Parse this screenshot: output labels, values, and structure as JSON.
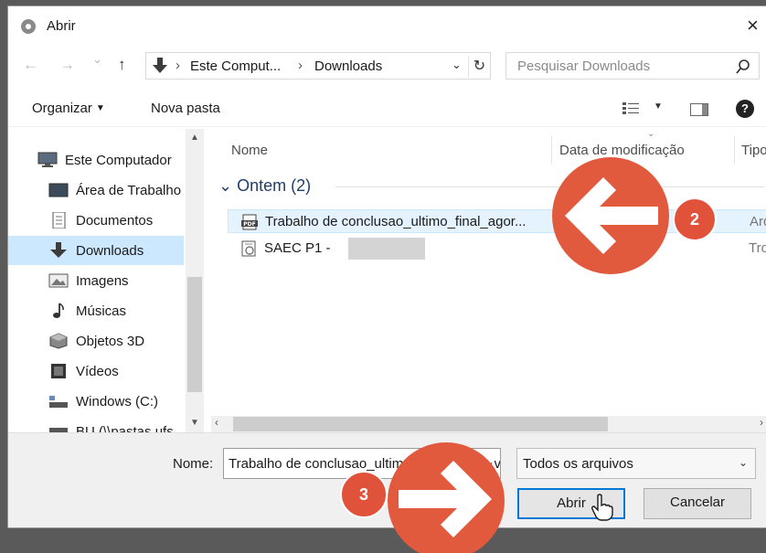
{
  "dialog": {
    "title": "Abrir",
    "close_glyph": "×"
  },
  "navbar": {
    "back_glyph": "←",
    "forward_glyph": "→",
    "history_glyph": "⌄",
    "up_glyph": "↑",
    "address": {
      "segment_1": "Este Comput...",
      "separator": "›",
      "segment_2": "Downloads",
      "dropdown_glyph": "⌄",
      "refresh_glyph": "↻"
    },
    "search_placeholder": "Pesquisar Downloads"
  },
  "toolbar": {
    "organize_label": "Organizar",
    "organize_caret": "▼",
    "new_folder_label": "Nova pasta",
    "view_caret": "▼",
    "help_glyph": "?"
  },
  "sidebar": {
    "items": [
      {
        "label": "Este Computador",
        "icon": "computer-icon"
      },
      {
        "label": "Área de Trabalho",
        "icon": "desktop-icon"
      },
      {
        "label": "Documentos",
        "icon": "documents-icon"
      },
      {
        "label": "Downloads",
        "icon": "downloads-icon",
        "selected": true
      },
      {
        "label": "Imagens",
        "icon": "images-icon"
      },
      {
        "label": "Músicas",
        "icon": "music-icon"
      },
      {
        "label": "Objetos 3D",
        "icon": "objects-3d-icon"
      },
      {
        "label": "Vídeos",
        "icon": "videos-icon"
      },
      {
        "label": "Windows (C:)",
        "icon": "drive-icon"
      },
      {
        "label": "BU (\\\\pastas.ufs",
        "icon": "network-drive-icon"
      }
    ],
    "scroll_up_glyph": "▲",
    "scroll_down_glyph": "▼"
  },
  "file_list": {
    "columns": {
      "name": "Nome",
      "modified": "Data de modificação",
      "type": "Tipo"
    },
    "sort_glyph": "⌄",
    "group": {
      "chevron": "⌄",
      "label": "Ontem (2)"
    },
    "rows": [
      {
        "name": "Trabalho de conclusao_ultimo_final_agor...",
        "type": "Arqu",
        "icon": "pdf-file-icon",
        "selected": true
      },
      {
        "name": "SAEC P1 -",
        "type": "Troc",
        "icon": "certificate-file-icon",
        "selected": false
      }
    ],
    "scroll_left_glyph": "‹",
    "scroll_right_glyph": "›"
  },
  "footer": {
    "name_label": "Nome:",
    "name_value": "Trabalho de conclusao_ultimo_final_agora_vai.pdf",
    "name_caret": "⌄",
    "filter_value": "Todos os arquivos",
    "filter_caret": "⌄",
    "open_label": "Abrir",
    "cancel_label": "Cancelar"
  },
  "annotations": {
    "step_2": "2",
    "step_3": "3"
  },
  "colors": {
    "accent": "#0078d7",
    "selection": "#cce8ff",
    "annotation": "#e15a3e"
  }
}
